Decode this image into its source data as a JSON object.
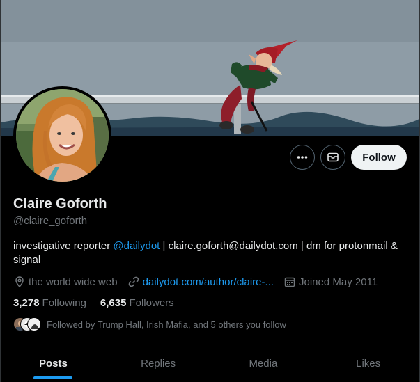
{
  "profile": {
    "name": "Claire Goforth",
    "handle": "@claire_goforth",
    "bio_prefix": "investigative reporter ",
    "bio_mention": "@dailydot",
    "bio_suffix": " | claire.goforth@dailydot.com | dm for protonmail & signal",
    "location": "the world wide web",
    "website": "dailydot.com/author/claire-...",
    "joined": "Joined May 2011",
    "following_count": "3,278",
    "following_label": "Following",
    "followers_count": "6,635",
    "followers_label": "Followers",
    "followed_by": "Followed by Trump Hall, Irish Mafia, and 5 others you follow"
  },
  "actions": {
    "follow_label": "Follow"
  },
  "tabs": [
    {
      "label": "Posts",
      "active": true
    },
    {
      "label": "Replies",
      "active": false
    },
    {
      "label": "Media",
      "active": false
    },
    {
      "label": "Likes",
      "active": false
    }
  ],
  "icons": {
    "more": "more-icon",
    "message": "envelope-icon",
    "location": "location-pin-icon",
    "link": "link-icon",
    "calendar": "calendar-icon"
  },
  "colors": {
    "accent": "#1d9bf0",
    "background": "#000000",
    "text_primary": "#e7e9ea",
    "text_secondary": "#71767b",
    "follow_button_bg": "#eff3f4"
  }
}
